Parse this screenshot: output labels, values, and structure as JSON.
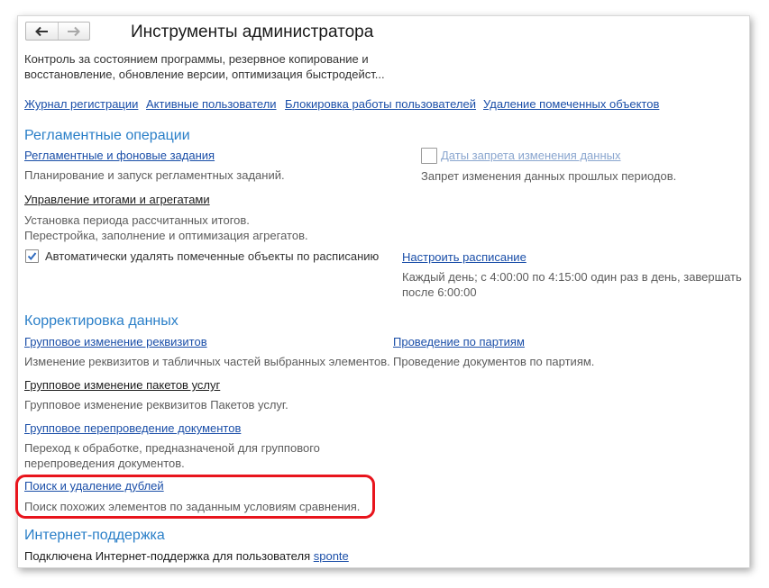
{
  "window": {
    "title": "Инструменты администратора",
    "description": "Контроль за состоянием программы, резервное копирование и восстановление, обновление версии, оптимизация быстродейст..."
  },
  "nav": {
    "back_icon": "arrow-left-icon",
    "forward_icon": "arrow-right-icon"
  },
  "top_links": [
    "Журнал регистрации",
    "Активные пользователи",
    "Блокировка работы пользователей",
    "Удаление помеченных объектов"
  ],
  "scheduled": {
    "heading": "Регламентные операции",
    "jobs_link": "Регламентные и фоновые задания",
    "jobs_note": "Планирование и запуск регламентных заданий.",
    "totals_link": "Управление итогами и агрегатами",
    "totals_note_1": "Установка периода рассчитанных итогов.",
    "totals_note_2": "Перестройка, заполнение и оптимизация агрегатов.",
    "auto_delete_label": "Автоматически удалять помеченные объекты по расписанию",
    "auto_delete_checked": true,
    "schedule_link": "Настроить расписание",
    "schedule_note": "Каждый день; с 4:00:00 по 4:15:00 один раз в день, завершать после 6:00:00",
    "prohibit_label": "Даты запрета изменения данных",
    "prohibit_checked": false,
    "prohibit_note": "Запрет изменения данных прошлых периодов."
  },
  "data_correction": {
    "heading": "Корректировка данных",
    "group_change_link": "Групповое изменение реквизитов",
    "group_change_note": "Изменение реквизитов и табличных частей выбранных элементов.",
    "batch_posting_link": "Проведение по партиям",
    "batch_posting_note": "Проведение документов по партиям.",
    "service_packages_link": "Групповое изменение пакетов услуг",
    "service_packages_note": "Групповое изменение реквизитов Пакетов услуг.",
    "reposting_link": "Групповое перепроведение документов",
    "reposting_note": "Переход к обработке, предназначеной для группового перепроведения документов.",
    "duplicates_link": "Поиск и удаление дублей",
    "duplicates_note": "Поиск похожих элементов по заданным условиям сравнения."
  },
  "internet_support": {
    "heading": "Интернет-поддержка",
    "status_text": "Подключена Интернет-поддержка для пользователя",
    "user_link": "sponte"
  },
  "colors": {
    "section": "#2a7fc8",
    "link": "#1a4ea8",
    "highlight": "#e8141c"
  }
}
